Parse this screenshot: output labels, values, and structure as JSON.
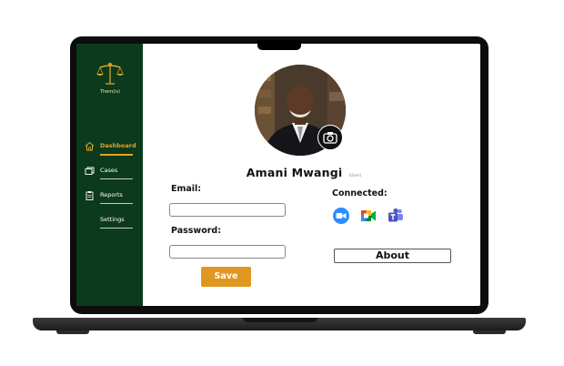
{
  "brand": {
    "name": "Them(is)"
  },
  "sidebar": {
    "items": [
      {
        "label": "Dashboard",
        "icon": "home-icon",
        "active": true
      },
      {
        "label": "Cases",
        "icon": "folders-icon",
        "active": false
      },
      {
        "label": "Reports",
        "icon": "clipboard-icon",
        "active": false
      },
      {
        "label": "Settings",
        "icon": "",
        "active": false
      }
    ]
  },
  "profile": {
    "name": "Amani Mwangi",
    "role": "(User)",
    "avatar_icon": "profile-photo",
    "camera_icon": "camera-icon"
  },
  "form": {
    "email_label": "Email:",
    "email_value": "",
    "password_label": "Password:",
    "password_value": "",
    "save_label": "Save"
  },
  "connected": {
    "label": "Connected:",
    "apps": [
      {
        "name": "Zoom",
        "icon": "zoom-icon"
      },
      {
        "name": "Google Meet",
        "icon": "google-meet-icon"
      },
      {
        "name": "Microsoft Teams",
        "icon": "teams-icon"
      }
    ]
  },
  "about_label": "About",
  "colors": {
    "sidebar": "#0c3a1c",
    "accent": "#e3a323",
    "save_button": "#e09722"
  }
}
